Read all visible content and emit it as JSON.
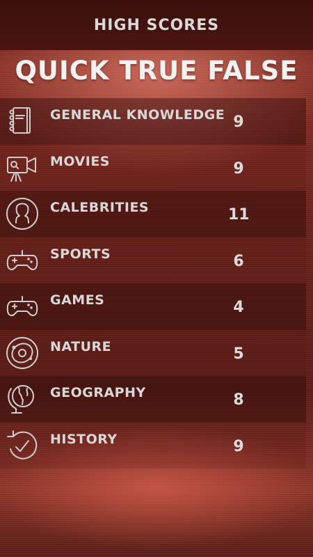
{
  "header": {
    "title": "HIGH SCORES"
  },
  "quiz": {
    "title": "QUICK TRUE FALSE"
  },
  "scores": [
    {
      "category": "GENERAL KNOWLEDGE",
      "score": "9",
      "icon": "notebook-icon"
    },
    {
      "category": "MOVIES",
      "score": "9",
      "icon": "video-camera-icon"
    },
    {
      "category": "CALEBRITIES",
      "score": "11",
      "icon": "person-profile-icon"
    },
    {
      "category": "SPORTS",
      "score": "6",
      "icon": "gamepad-icon"
    },
    {
      "category": "GAMES",
      "score": "4",
      "icon": "gamepad-icon"
    },
    {
      "category": "NATURE",
      "score": "5",
      "icon": "solar-system-icon"
    },
    {
      "category": "GEOGRAPHY",
      "score": "8",
      "icon": "globe-icon"
    },
    {
      "category": "HISTORY",
      "score": "9",
      "icon": "clock-history-icon"
    }
  ]
}
